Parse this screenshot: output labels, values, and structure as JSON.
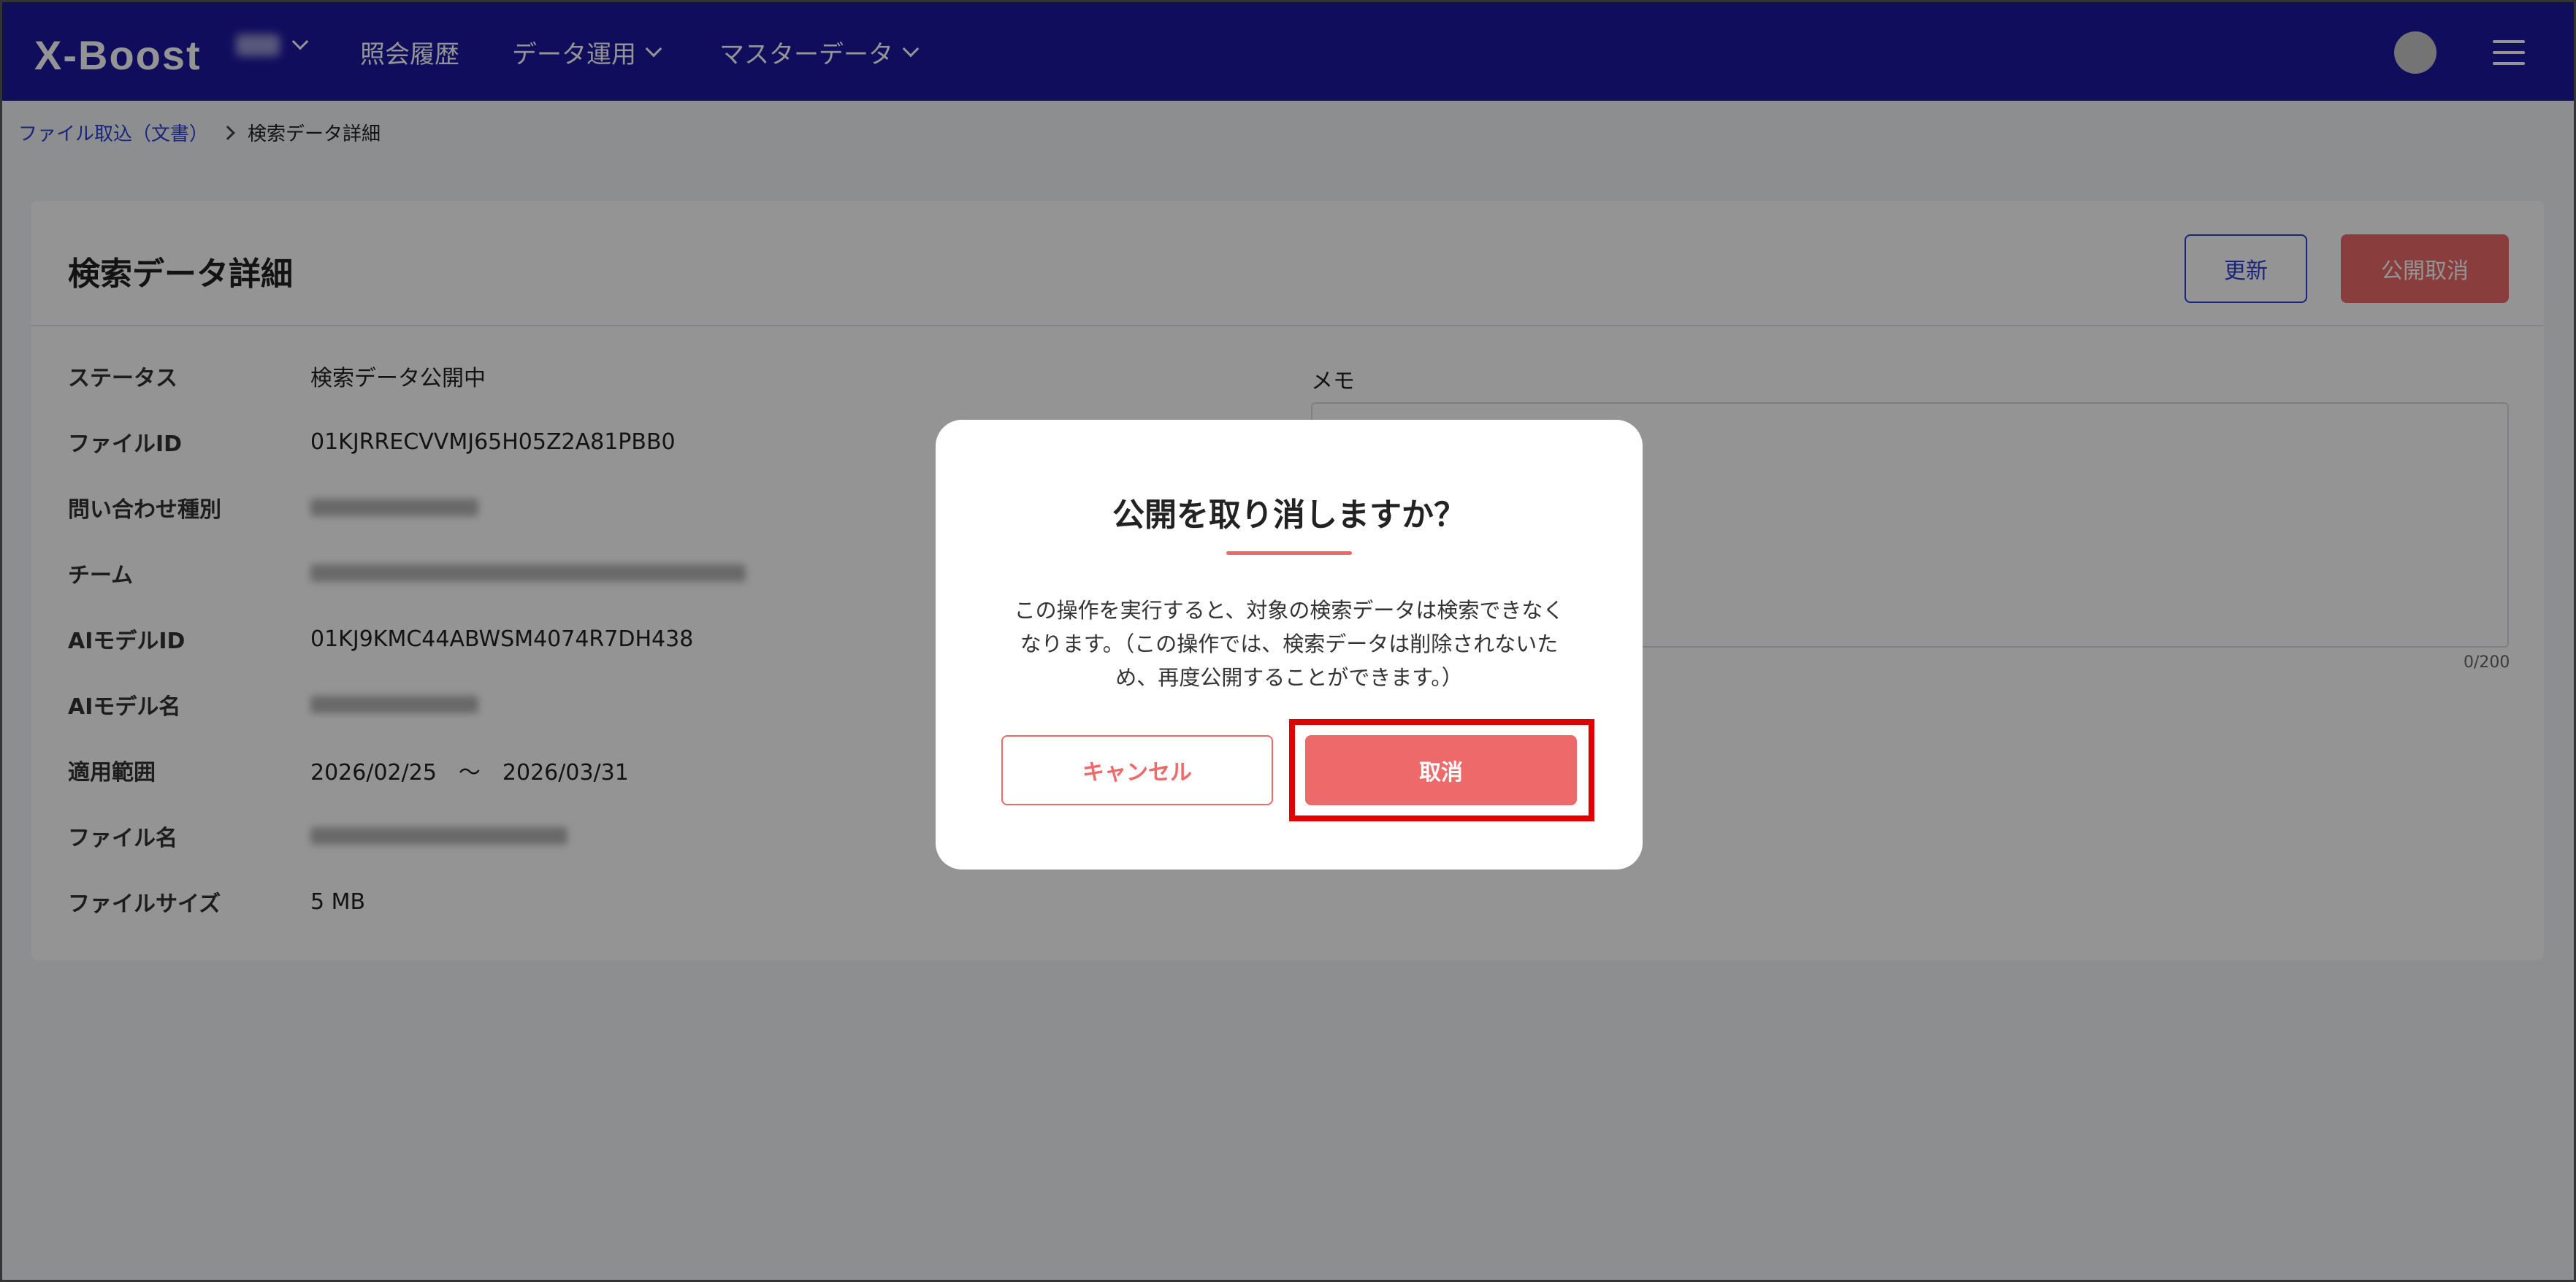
{
  "header": {
    "logo": "X-Boost",
    "nav": [
      {
        "label": "照会履歴"
      },
      {
        "label": "データ運用"
      },
      {
        "label": "マスターデータ"
      }
    ]
  },
  "breadcrumb": {
    "parent": "ファイル取込（文書）",
    "current": "検索データ詳細"
  },
  "page": {
    "title": "検索データ詳細",
    "update_label": "更新",
    "unpublish_label": "公開取消"
  },
  "details": [
    {
      "label": "ステータス",
      "value": "検索データ公開中"
    },
    {
      "label": "ファイルID",
      "value": "01KJRRECVVMJ65H05Z2A81PBB0"
    },
    {
      "label": "問い合わせ種別",
      "value": ""
    },
    {
      "label": "チーム",
      "value": ""
    },
    {
      "label": "AIモデルID",
      "value": "01KJ9KMC44ABWSM4074R7DH438"
    },
    {
      "label": "AIモデル名",
      "value": ""
    },
    {
      "label": "適用範囲",
      "value": "2026/02/25　～　2026/03/31"
    },
    {
      "label": "ファイル名",
      "value": ""
    },
    {
      "label": "ファイルサイズ",
      "value": "5 MB"
    }
  ],
  "memo": {
    "label": "メモ",
    "count": "0/200"
  },
  "modal": {
    "title": "公開を取り消しますか？",
    "body_line1": "この操作を実行すると、対象の検索データは検索できなく",
    "body_line2": "なります。（この操作では、検索データは削除されないた",
    "body_line3": "め、再度公開することができます。）",
    "cancel_label": "キャンセル",
    "confirm_label": "取消"
  },
  "colors": {
    "header_bg": "#1c18a0",
    "accent_red": "#ee6a6a",
    "link_blue": "#2b3fd4",
    "highlight": "#e00000"
  }
}
